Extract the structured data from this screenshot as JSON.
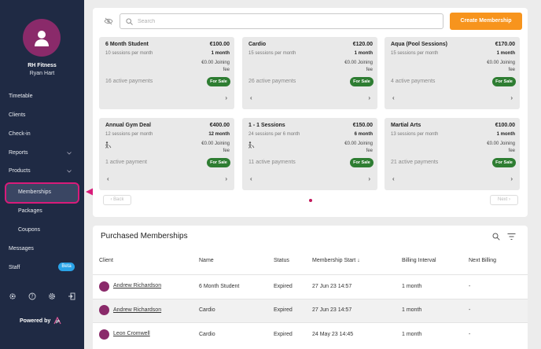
{
  "sidebar": {
    "org_name": "RH Fitness",
    "user_name": "Ryan Hart",
    "nav": {
      "timetable": "Timetable",
      "clients": "Clients",
      "checkin": "Check-in",
      "reports": "Reports",
      "products": "Products",
      "memberships": "Memberships",
      "packages": "Packages",
      "coupons": "Coupons",
      "messages": "Messages",
      "staff": "Staff",
      "beta": "Beta"
    },
    "powered_by": "Powered by"
  },
  "toolbar": {
    "search_placeholder": "Search",
    "create_label": "Create Membership"
  },
  "cards": [
    {
      "name": "6 Month Student",
      "price": "€100.00",
      "sessions": "10 sessions per month",
      "duration": "1 month",
      "fee1": "€0.00 Joining",
      "fee2": "fee",
      "payments": "16 active payments",
      "status": "For Sale",
      "prev": "",
      "next": "›"
    },
    {
      "name": "Cardio",
      "price": "€120.00",
      "sessions": "15 sessions per month",
      "duration": "1 month",
      "fee1": "€0.00 Joining",
      "fee2": "fee",
      "payments": "26 active payments",
      "status": "For Sale",
      "prev": "‹",
      "next": "›"
    },
    {
      "name": "Aqua (Pool Sessions)",
      "price": "€170.00",
      "sessions": "15 sessions per month",
      "duration": "1 month",
      "fee1": "€0.00 Joining",
      "fee2": "fee",
      "payments": "4 active payments",
      "status": "For Sale",
      "prev": "‹",
      "next": "›"
    },
    {
      "name": "Annual Gym Deal",
      "price": "€400.00",
      "sessions": "12 sessions per month",
      "duration": "12 month",
      "fee1": "€0.00 Joining",
      "fee2": "fee",
      "payments": "1 active payment",
      "status": "For Sale",
      "prev": "‹",
      "next": "›"
    },
    {
      "name": "1 - 1 Sessions",
      "price": "€150.00",
      "sessions": "24 sessions per 6 month",
      "duration": "6 month",
      "fee1": "€0.00 Joining",
      "fee2": "fee",
      "payments": "11 active payments",
      "status": "For Sale",
      "prev": "‹",
      "next": "›"
    },
    {
      "name": "Martial Arts",
      "price": "€100.00",
      "sessions": "13 sessions per month",
      "duration": "1 month",
      "fee1": "€0.00 Joining",
      "fee2": "fee",
      "payments": "21 active payments",
      "status": "For Sale",
      "prev": "‹",
      "next": "›"
    }
  ],
  "pager": {
    "back": "Back",
    "next": "Next"
  },
  "purchased": {
    "title": "Purchased Memberships",
    "headers": {
      "client": "Client",
      "name": "Name",
      "status": "Status",
      "start": "Membership Start",
      "interval": "Billing Interval",
      "next_billing": "Next Billing"
    },
    "rows": [
      {
        "client": "Andrew Richardson",
        "name": "6 Month Student",
        "status": "Expired",
        "start": "27 Jun 23 14:57",
        "interval": "1 month",
        "next_billing": "-"
      },
      {
        "client": "Andrew Richardson",
        "name": "Cardio",
        "status": "Expired",
        "start": "27 Jun 23 14:57",
        "interval": "1 month",
        "next_billing": "-"
      },
      {
        "client": "Leon Cromwell",
        "name": "Cardio",
        "status": "Expired",
        "start": "24 May 23 14:45",
        "interval": "1 month",
        "next_billing": "-"
      }
    ]
  },
  "colors": {
    "sidebar": "#1f2a44",
    "accent": "#f7941d",
    "brand": "#8a2a6a",
    "for_sale": "#2e7d32",
    "highlight": "#d81b7a"
  }
}
